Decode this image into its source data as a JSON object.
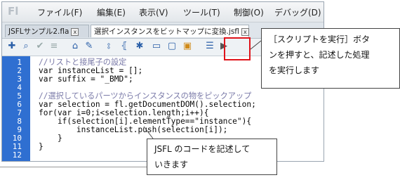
{
  "app": {
    "logo": "Fl"
  },
  "menu": {
    "items": [
      "ファイル(F)",
      "編集(E)",
      "表示(V)",
      "ツール(T)",
      "制御(O)",
      "デバッグ(D)"
    ]
  },
  "tabs": [
    {
      "label": "JSFLサンプル2.fla",
      "close": "x"
    },
    {
      "label": "選択インスタンスをビットマップに変換.jsfl",
      "close": "x"
    }
  ],
  "toolbar": {
    "icons": [
      "add-script-icon",
      "find-icon",
      "check-syntax-icon",
      "format-icon",
      "code-hint-icon",
      "debug-icon",
      "collapse-icon",
      "expand-icon",
      "collapse-selection-icon",
      "comment-icon",
      "comment-block-icon",
      "uncomment-icon",
      "options-icon",
      "run-script-icon"
    ],
    "glyphs": [
      "✚",
      "⌕",
      "✔",
      "≡",
      "⌂",
      "✎",
      "⦂",
      "⦃",
      "✱",
      "▭",
      "▢",
      "▣",
      "☰",
      "▶"
    ]
  },
  "code": {
    "line_numbers": [
      "1",
      "2",
      "3",
      "4",
      "5",
      "6",
      "7",
      "8",
      "9",
      "10",
      "11",
      "12"
    ],
    "lines": [
      "//リストと接尾子の設定",
      "var instanceList = [];",
      "var suffix = \"_BMD\";",
      "",
      "//選択しているパーツからインスタンスの物をピックアップ",
      "var selection = fl.getDocumentDOM().selection;",
      "for(var i=0;i<selection.length;i++){",
      "    if(selection[i].elementType==\"instance\"){",
      "        instanceList.push(selection[i]);",
      "    }",
      "}",
      ""
    ]
  },
  "callouts": {
    "run": [
      "［スクリプトを実行］ボタ",
      "ンを押すと、記述した処理",
      "を実行します"
    ],
    "code": [
      "JSFL のコードを記述して",
      "いきます"
    ]
  },
  "colors": {
    "gutter": "#2f6fd1",
    "highlight_box": "#e0141b",
    "keyword": "#1a1ab0",
    "comment": "#7a7aa8",
    "string": "#2a8a2a"
  }
}
